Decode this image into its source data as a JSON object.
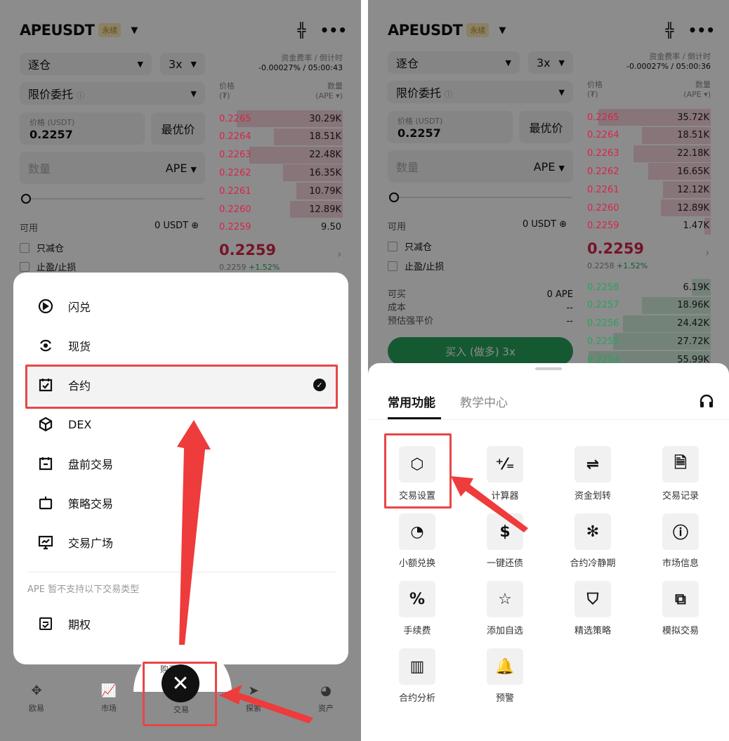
{
  "symbol": "APEUSDT",
  "badge": "永续",
  "funding_label": "资金费率 / 倒计时",
  "margin_mode": "逐仓",
  "leverage": "3x",
  "order_type": "限价委托",
  "price_label": "价格 (USDT)",
  "price_value": "0.2257",
  "best_price_btn": "最优价",
  "qty_placeholder": "数量",
  "qty_unit": "APE",
  "orderbook_price_header": "价格",
  "orderbook_price_unit": "(₮)",
  "orderbook_qty_header": "数量",
  "orderbook_qty_unit": "(APE ▾)",
  "available_label": "可用",
  "available_value": "0 USDT",
  "reduce_only": "只减仓",
  "tp_sl": "止盈/止损",
  "last_price": "0.2259",
  "colors": {
    "ask": "#d6254b",
    "bid": "#27a35c",
    "highlight": "#e84646"
  },
  "left": {
    "funding_value": "-0.00027% / 05:00:43",
    "asks": [
      {
        "price": "0.2265",
        "qty": "30.29K",
        "depth": 0.85
      },
      {
        "price": "0.2264",
        "qty": "18.51K",
        "depth": 0.55
      },
      {
        "price": "0.2263",
        "qty": "22.48K",
        "depth": 0.75
      },
      {
        "price": "0.2262",
        "qty": "16.35K",
        "depth": 0.48
      },
      {
        "price": "0.2261",
        "qty": "10.79K",
        "depth": 0.37
      },
      {
        "price": "0.2260",
        "qty": "12.89K",
        "depth": 0.42
      },
      {
        "price": "0.2259",
        "qty": "9.50",
        "depth": 0.0
      }
    ],
    "sub_price": "0.2259",
    "change": "+1.52%",
    "menu": [
      {
        "label": "闪兑",
        "icon": "swap-icon"
      },
      {
        "label": "现货",
        "icon": "spot-cycle-icon"
      },
      {
        "label": "合约",
        "icon": "futures-icon",
        "active": true
      },
      {
        "label": "DEX",
        "icon": "dex-cube-icon"
      },
      {
        "label": "盘前交易",
        "icon": "premarket-icon"
      },
      {
        "label": "策略交易",
        "icon": "bot-icon"
      },
      {
        "label": "交易广场",
        "icon": "trading-square-icon"
      }
    ],
    "unsupported_note": "APE 暂不支持以下交易类型",
    "options_label": "期权",
    "nav": [
      "欧易",
      "市场",
      "交易",
      "探索",
      "资产"
    ],
    "hidden_text": "购买资"
  },
  "right": {
    "funding_value": "-0.00027% / 05:00:36",
    "asks": [
      {
        "price": "0.2265",
        "qty": "35.72K",
        "depth": 0.9
      },
      {
        "price": "0.2264",
        "qty": "18.51K",
        "depth": 0.55
      },
      {
        "price": "0.2263",
        "qty": "22.18K",
        "depth": 0.62
      },
      {
        "price": "0.2262",
        "qty": "16.65K",
        "depth": 0.5
      },
      {
        "price": "0.2261",
        "qty": "12.12K",
        "depth": 0.38
      },
      {
        "price": "0.2260",
        "qty": "12.89K",
        "depth": 0.4
      },
      {
        "price": "0.2259",
        "qty": "1.47K",
        "depth": 0.05
      }
    ],
    "bids": [
      {
        "price": "0.2258",
        "qty": "6.19K",
        "depth": 0.15
      },
      {
        "price": "0.2257",
        "qty": "18.96K",
        "depth": 0.55
      },
      {
        "price": "0.2256",
        "qty": "24.42K",
        "depth": 0.7
      },
      {
        "price": "0.2255",
        "qty": "27.72K",
        "depth": 0.78
      },
      {
        "price": "0.2254",
        "qty": "55.99K",
        "depth": 0.98
      }
    ],
    "sub_price": "0.2258",
    "change": "+1.52%",
    "can_buy_label": "可买",
    "can_buy_value": "0 APE",
    "cost_label": "成本",
    "cost_value": "--",
    "liq_label": "预估强平价",
    "liq_value": "--",
    "buy_button": "买入 (做多) 3x",
    "tabs": [
      "常用功能",
      "教学中心"
    ],
    "grid": [
      {
        "label": "交易设置",
        "icon": "settings-hex-icon",
        "glyph": "⬡"
      },
      {
        "label": "计算器",
        "icon": "calculator-icon",
        "glyph": "⁺⁄₌"
      },
      {
        "label": "资金划转",
        "icon": "transfer-icon",
        "glyph": "⇌"
      },
      {
        "label": "交易记录",
        "icon": "trade-history-icon",
        "glyph": "🗎"
      },
      {
        "label": "小额兑换",
        "icon": "small-convert-icon",
        "glyph": "◔"
      },
      {
        "label": "一键还债",
        "icon": "repay-icon",
        "glyph": "$"
      },
      {
        "label": "合约冷静期",
        "icon": "cooldown-snowflake-icon",
        "glyph": "✻"
      },
      {
        "label": "市场信息",
        "icon": "info-icon",
        "glyph": "ⓘ"
      },
      {
        "label": "手续费",
        "icon": "fee-percent-icon",
        "glyph": "%"
      },
      {
        "label": "添加自选",
        "icon": "star-icon",
        "glyph": "☆"
      },
      {
        "label": "精选策略",
        "icon": "strategy-icon",
        "glyph": "⛉"
      },
      {
        "label": "模拟交易",
        "icon": "demo-trading-icon",
        "glyph": "⧉"
      },
      {
        "label": "合约分析",
        "icon": "analysis-chart-icon",
        "glyph": "▥"
      },
      {
        "label": "预警",
        "icon": "bell-icon",
        "glyph": "🔔"
      }
    ]
  }
}
